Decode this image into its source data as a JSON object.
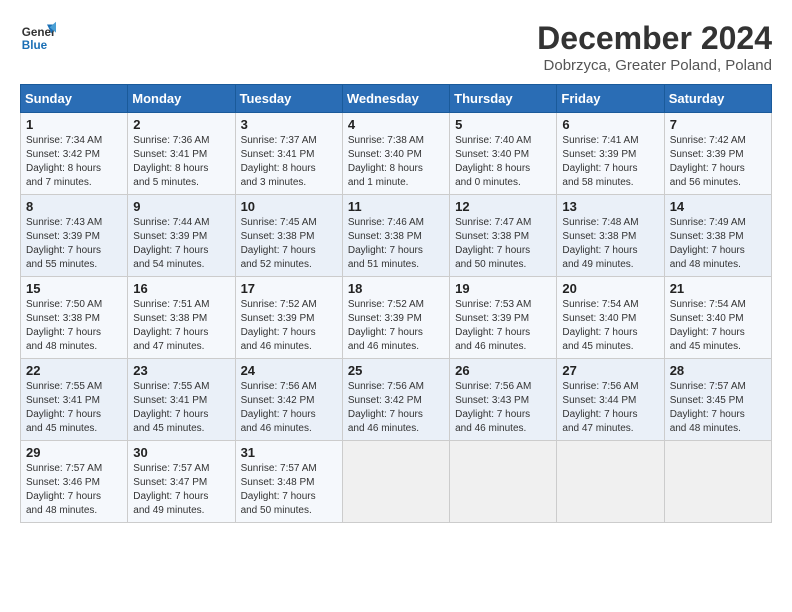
{
  "header": {
    "logo_line1": "General",
    "logo_line2": "Blue",
    "title": "December 2024",
    "subtitle": "Dobrzyca, Greater Poland, Poland"
  },
  "calendar": {
    "days_of_week": [
      "Sunday",
      "Monday",
      "Tuesday",
      "Wednesday",
      "Thursday",
      "Friday",
      "Saturday"
    ],
    "weeks": [
      [
        {
          "day": "1",
          "info": "Sunrise: 7:34 AM\nSunset: 3:42 PM\nDaylight: 8 hours\nand 7 minutes."
        },
        {
          "day": "2",
          "info": "Sunrise: 7:36 AM\nSunset: 3:41 PM\nDaylight: 8 hours\nand 5 minutes."
        },
        {
          "day": "3",
          "info": "Sunrise: 7:37 AM\nSunset: 3:41 PM\nDaylight: 8 hours\nand 3 minutes."
        },
        {
          "day": "4",
          "info": "Sunrise: 7:38 AM\nSunset: 3:40 PM\nDaylight: 8 hours\nand 1 minute."
        },
        {
          "day": "5",
          "info": "Sunrise: 7:40 AM\nSunset: 3:40 PM\nDaylight: 8 hours\nand 0 minutes."
        },
        {
          "day": "6",
          "info": "Sunrise: 7:41 AM\nSunset: 3:39 PM\nDaylight: 7 hours\nand 58 minutes."
        },
        {
          "day": "7",
          "info": "Sunrise: 7:42 AM\nSunset: 3:39 PM\nDaylight: 7 hours\nand 56 minutes."
        }
      ],
      [
        {
          "day": "8",
          "info": "Sunrise: 7:43 AM\nSunset: 3:39 PM\nDaylight: 7 hours\nand 55 minutes."
        },
        {
          "day": "9",
          "info": "Sunrise: 7:44 AM\nSunset: 3:39 PM\nDaylight: 7 hours\nand 54 minutes."
        },
        {
          "day": "10",
          "info": "Sunrise: 7:45 AM\nSunset: 3:38 PM\nDaylight: 7 hours\nand 52 minutes."
        },
        {
          "day": "11",
          "info": "Sunrise: 7:46 AM\nSunset: 3:38 PM\nDaylight: 7 hours\nand 51 minutes."
        },
        {
          "day": "12",
          "info": "Sunrise: 7:47 AM\nSunset: 3:38 PM\nDaylight: 7 hours\nand 50 minutes."
        },
        {
          "day": "13",
          "info": "Sunrise: 7:48 AM\nSunset: 3:38 PM\nDaylight: 7 hours\nand 49 minutes."
        },
        {
          "day": "14",
          "info": "Sunrise: 7:49 AM\nSunset: 3:38 PM\nDaylight: 7 hours\nand 48 minutes."
        }
      ],
      [
        {
          "day": "15",
          "info": "Sunrise: 7:50 AM\nSunset: 3:38 PM\nDaylight: 7 hours\nand 48 minutes."
        },
        {
          "day": "16",
          "info": "Sunrise: 7:51 AM\nSunset: 3:38 PM\nDaylight: 7 hours\nand 47 minutes."
        },
        {
          "day": "17",
          "info": "Sunrise: 7:52 AM\nSunset: 3:39 PM\nDaylight: 7 hours\nand 46 minutes."
        },
        {
          "day": "18",
          "info": "Sunrise: 7:52 AM\nSunset: 3:39 PM\nDaylight: 7 hours\nand 46 minutes."
        },
        {
          "day": "19",
          "info": "Sunrise: 7:53 AM\nSunset: 3:39 PM\nDaylight: 7 hours\nand 46 minutes."
        },
        {
          "day": "20",
          "info": "Sunrise: 7:54 AM\nSunset: 3:40 PM\nDaylight: 7 hours\nand 45 minutes."
        },
        {
          "day": "21",
          "info": "Sunrise: 7:54 AM\nSunset: 3:40 PM\nDaylight: 7 hours\nand 45 minutes."
        }
      ],
      [
        {
          "day": "22",
          "info": "Sunrise: 7:55 AM\nSunset: 3:41 PM\nDaylight: 7 hours\nand 45 minutes."
        },
        {
          "day": "23",
          "info": "Sunrise: 7:55 AM\nSunset: 3:41 PM\nDaylight: 7 hours\nand 45 minutes."
        },
        {
          "day": "24",
          "info": "Sunrise: 7:56 AM\nSunset: 3:42 PM\nDaylight: 7 hours\nand 46 minutes."
        },
        {
          "day": "25",
          "info": "Sunrise: 7:56 AM\nSunset: 3:42 PM\nDaylight: 7 hours\nand 46 minutes."
        },
        {
          "day": "26",
          "info": "Sunrise: 7:56 AM\nSunset: 3:43 PM\nDaylight: 7 hours\nand 46 minutes."
        },
        {
          "day": "27",
          "info": "Sunrise: 7:56 AM\nSunset: 3:44 PM\nDaylight: 7 hours\nand 47 minutes."
        },
        {
          "day": "28",
          "info": "Sunrise: 7:57 AM\nSunset: 3:45 PM\nDaylight: 7 hours\nand 48 minutes."
        }
      ],
      [
        {
          "day": "29",
          "info": "Sunrise: 7:57 AM\nSunset: 3:46 PM\nDaylight: 7 hours\nand 48 minutes."
        },
        {
          "day": "30",
          "info": "Sunrise: 7:57 AM\nSunset: 3:47 PM\nDaylight: 7 hours\nand 49 minutes."
        },
        {
          "day": "31",
          "info": "Sunrise: 7:57 AM\nSunset: 3:48 PM\nDaylight: 7 hours\nand 50 minutes."
        },
        {
          "day": "",
          "info": ""
        },
        {
          "day": "",
          "info": ""
        },
        {
          "day": "",
          "info": ""
        },
        {
          "day": "",
          "info": ""
        }
      ]
    ]
  }
}
